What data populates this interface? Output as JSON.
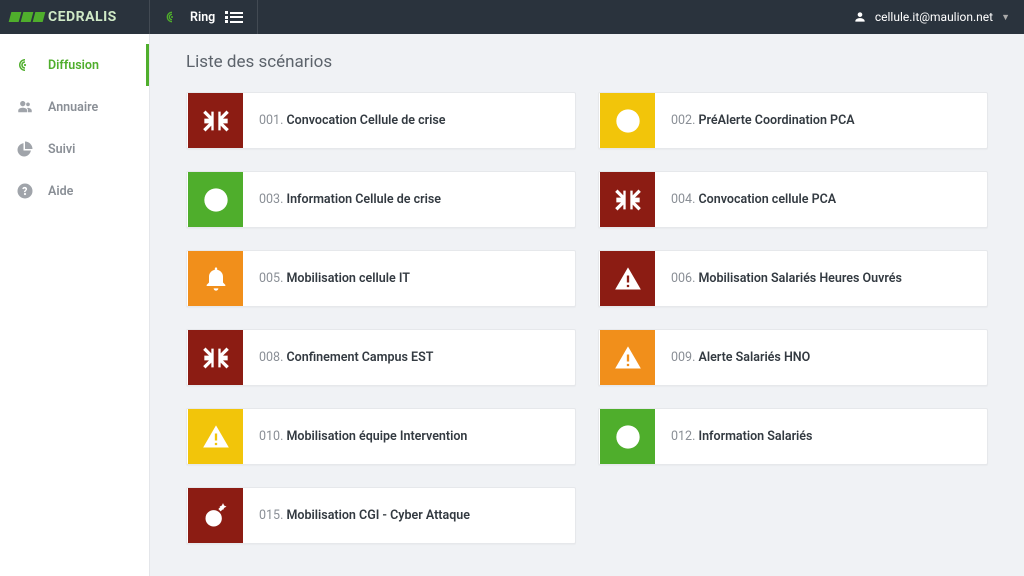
{
  "app": {
    "brand": "CEDRALIS",
    "module": "Ring"
  },
  "user": {
    "label": "cellule.it@maulion.net"
  },
  "nav": {
    "diffusion": "Diffusion",
    "annuaire": "Annuaire",
    "suivi": "Suivi",
    "aide": "Aide"
  },
  "page": {
    "title": "Liste des scénarios"
  },
  "scenarios": [
    {
      "num": "001.",
      "title": "Convocation Cellule de crise",
      "icon": "compress",
      "color": "bg-dkred"
    },
    {
      "num": "002.",
      "title": "PréAlerte Coordination PCA",
      "icon": "info",
      "color": "bg-yellow",
      "dark": true
    },
    {
      "num": "003.",
      "title": "Information Cellule de crise",
      "icon": "info",
      "color": "bg-green"
    },
    {
      "num": "004.",
      "title": "Convocation cellule PCA",
      "icon": "compress",
      "color": "bg-dkred"
    },
    {
      "num": "005.",
      "title": "Mobilisation cellule IT",
      "icon": "bell",
      "color": "bg-orange"
    },
    {
      "num": "006.",
      "title": "Mobilisation Salariés Heures Ouvrés",
      "icon": "warn",
      "color": "bg-dkred"
    },
    {
      "num": "008.",
      "title": "Confinement Campus EST",
      "icon": "compress",
      "color": "bg-dkred"
    },
    {
      "num": "009.",
      "title": "Alerte Salariés HNO",
      "icon": "warn",
      "color": "bg-orange"
    },
    {
      "num": "010.",
      "title": "Mobilisation équipe Intervention",
      "icon": "warn",
      "color": "bg-yellow",
      "dark": true
    },
    {
      "num": "012.",
      "title": "Information Salariés",
      "icon": "info",
      "color": "bg-green"
    },
    {
      "num": "015.",
      "title": "Mobilisation CGI - Cyber Attaque",
      "icon": "bomb",
      "color": "bg-dkred"
    }
  ]
}
